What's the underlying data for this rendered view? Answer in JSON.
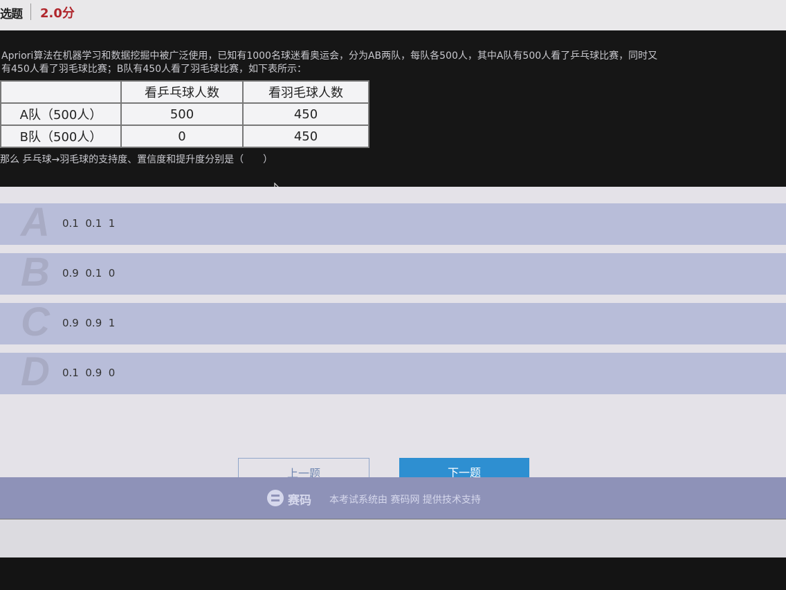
{
  "header": {
    "question_type": "选题",
    "score": "2.0分"
  },
  "stem": {
    "text": "Apriori算法在机器学习和数据挖掘中被广泛使用，已知有1000名球迷看奥运会，分为AB两队，每队各500人，其中A队有500人看了乒乓球比赛，同时又\n有450人看了羽毛球比赛；B队有450人看了羽毛球比赛，如下表所示：",
    "question": "那么 乒乓球→羽毛球的支持度、置信度和提升度分别是（　　）"
  },
  "table": {
    "headers": [
      "",
      "看乒乓球人数",
      "看羽毛球人数"
    ],
    "rows": [
      [
        "A队（500人）",
        "500",
        "450"
      ],
      [
        "B队（500人）",
        "0",
        "450"
      ]
    ]
  },
  "options": [
    {
      "letter": "A",
      "text": "0.1  0.1  1"
    },
    {
      "letter": "B",
      "text": "0.9  0.1  0"
    },
    {
      "letter": "C",
      "text": "0.9  0.9  1"
    },
    {
      "letter": "D",
      "text": "0.1  0.9  0"
    }
  ],
  "nav": {
    "prev_label": "上一题",
    "next_label": "下一题"
  },
  "footer": {
    "brand": "赛码",
    "text": "本考试系统由 赛码网 提供技术支持"
  }
}
